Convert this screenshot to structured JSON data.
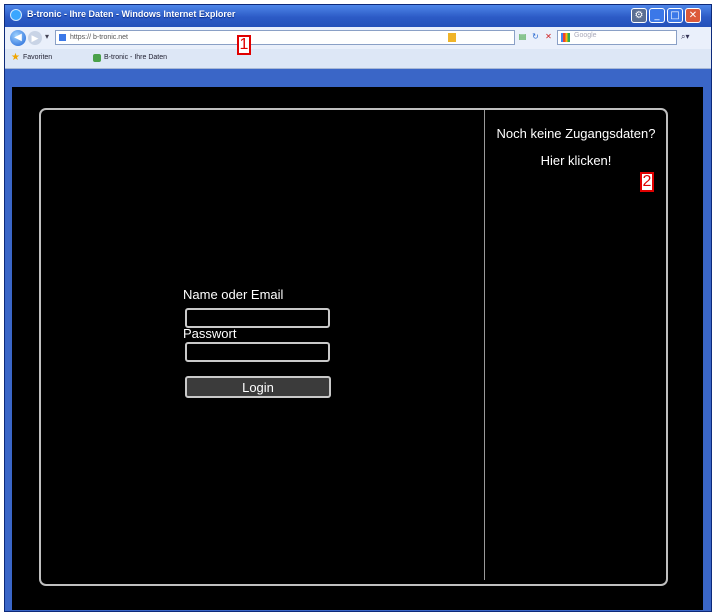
{
  "window": {
    "title": "B-tronic - Ihre Daten - Windows Internet Explorer"
  },
  "addressbar": {
    "url_prefix": "https://",
    "url_host": "b-tronic.net",
    "search_placeholder": "Google"
  },
  "favorites": {
    "favorites_label": "Favoriten",
    "tab_label": "B-tronic - Ihre Daten"
  },
  "right_panel": {
    "line1": "Noch keine Zugangsdaten?",
    "line2": "Hier klicken!"
  },
  "login_form": {
    "name_label": "Name oder Email",
    "name_value": "",
    "password_label": "Passwort",
    "password_value": "",
    "login_button": "Login"
  },
  "markers": [
    "1",
    "2"
  ],
  "colors": {
    "page_background": "#000000",
    "panel_border": "#bfbfbf",
    "marker_red": "#e00000"
  }
}
